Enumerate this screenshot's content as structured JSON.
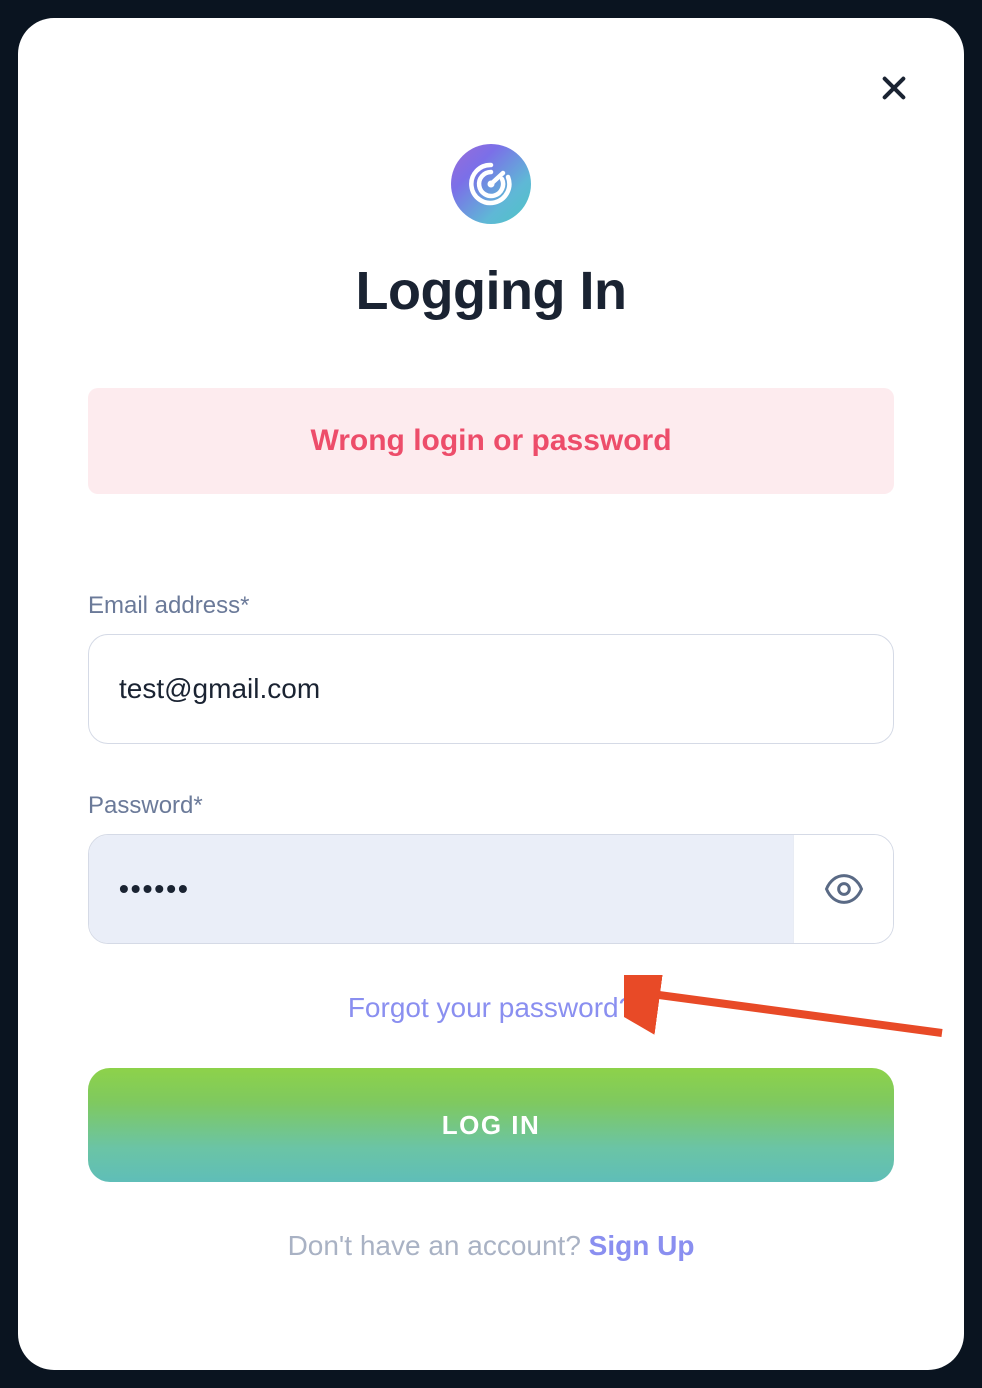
{
  "title": "Logging In",
  "error": {
    "message": "Wrong login or password"
  },
  "form": {
    "email_label": "Email address*",
    "email_value": "test@gmail.com",
    "password_label": "Password*",
    "password_masked": "••••••",
    "forgot_link": "Forgot your password?",
    "login_button": "LOG IN"
  },
  "signup": {
    "prefix": "Don't have an account? ",
    "link": "Sign Up"
  }
}
